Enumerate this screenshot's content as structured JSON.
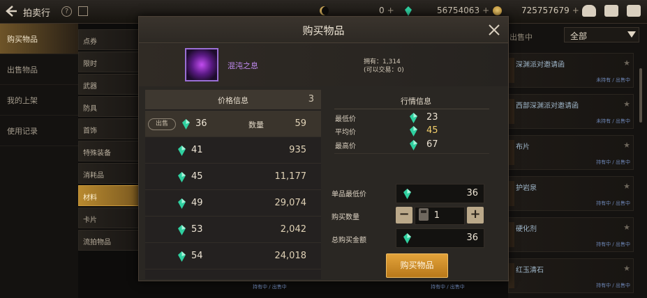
{
  "topbar": {
    "title": "拍卖行",
    "currency_1": "0",
    "currency_2": "56754063",
    "currency_3": "725757679",
    "plus": "+"
  },
  "leftnav": {
    "items": [
      {
        "label": "购买物品",
        "active": true
      },
      {
        "label": "出售物品",
        "active": false
      },
      {
        "label": "我的上架",
        "active": false
      },
      {
        "label": "使用记录",
        "active": false
      }
    ]
  },
  "categories": [
    {
      "label": "点券",
      "active": false
    },
    {
      "label": "限时",
      "active": false
    },
    {
      "label": "武器",
      "active": false
    },
    {
      "label": "防具",
      "active": false
    },
    {
      "label": "首饰",
      "active": false
    },
    {
      "label": "特殊装备",
      "active": false
    },
    {
      "label": "消耗品",
      "active": false
    },
    {
      "label": "材料",
      "active": true
    },
    {
      "label": "卡片",
      "active": false
    },
    {
      "label": "流拍物品",
      "active": false
    }
  ],
  "rightlist": {
    "selling_label": "出售中",
    "filter_value": "全部",
    "items": [
      {
        "name": "深渊派对邀请函",
        "status": "未持有 / 出售中"
      },
      {
        "name": "西部深渊派对邀请函",
        "status": "未持有 / 出售中"
      },
      {
        "name": "布片",
        "status": "持有中 / 出售中"
      },
      {
        "name": "护岩泉",
        "status": "持有中 / 出售中"
      },
      {
        "name": "硬化剂",
        "status": "持有中 / 出售中"
      },
      {
        "name": "红玉清石",
        "status": "持有中 / 出售中"
      }
    ]
  },
  "bottom_strip": {
    "status_a": "持有中 / 出售中",
    "status_b": "持有中 / 出售中"
  },
  "modal": {
    "title": "购买物品",
    "item": {
      "name": "混沌之息",
      "owned": "拥有：1,314",
      "tradable": "(可以交易：0)"
    },
    "price_info": {
      "title": "价格信息",
      "count": "3",
      "sell_tag": "出售",
      "qty_label": "数量",
      "rows": [
        {
          "price": "36",
          "qty": "59"
        },
        {
          "price": "41",
          "qty": "935"
        },
        {
          "price": "45",
          "qty": "11,177"
        },
        {
          "price": "49",
          "qty": "29,074"
        },
        {
          "price": "53",
          "qty": "2,042"
        },
        {
          "price": "54",
          "qty": "24,018"
        }
      ]
    },
    "market": {
      "title": "行情信息",
      "min_label": "最低价",
      "min_value": "23",
      "avg_label": "平均价",
      "avg_value": "45",
      "max_label": "最高价",
      "max_value": "67"
    },
    "form": {
      "unit_price_label": "单品最低价",
      "unit_price_value": "36",
      "quantity_label": "购买数量",
      "quantity_value": "1",
      "minus": "−",
      "plus": "+",
      "total_label": "总购买金额",
      "total_value": "36"
    },
    "buy_button": "购买物品"
  },
  "colors": {
    "accent_gold": "#e3a33b",
    "item_purple": "#c08af0",
    "gem_green": "#2fd0a0"
  },
  "icons": {
    "back": "back-arrow-icon",
    "close": "close-icon",
    "gem": "gem-icon",
    "star": "star-icon"
  }
}
